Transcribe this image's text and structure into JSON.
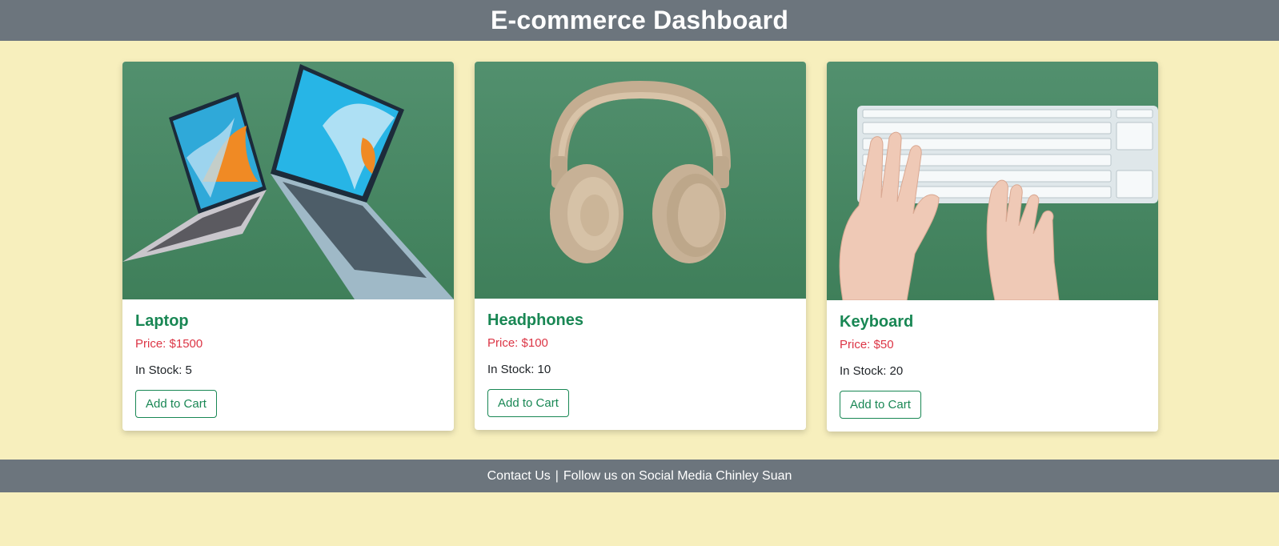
{
  "header": {
    "title": "E-commerce Dashboard"
  },
  "products": [
    {
      "name": "Laptop",
      "price": "Price: $1500",
      "stock": "In Stock: 5",
      "button": "Add to Cart",
      "image_icon": "laptop-image"
    },
    {
      "name": "Headphones",
      "price": "Price: $100",
      "stock": "In Stock: 10",
      "button": "Add to Cart",
      "image_icon": "headphones-image"
    },
    {
      "name": "Keyboard",
      "price": "Price: $50",
      "stock": "In Stock: 20",
      "button": "Add to Cart",
      "image_icon": "keyboard-image"
    }
  ],
  "footer": {
    "contact": "Contact Us",
    "separator": "|",
    "follow": "Follow us on Social Media Chinley Suan"
  },
  "colors": {
    "background": "#f7efbd",
    "bar": "#6c757d",
    "product_name": "#198754",
    "price": "#dc3545",
    "image_bg": "#4a8a66"
  }
}
